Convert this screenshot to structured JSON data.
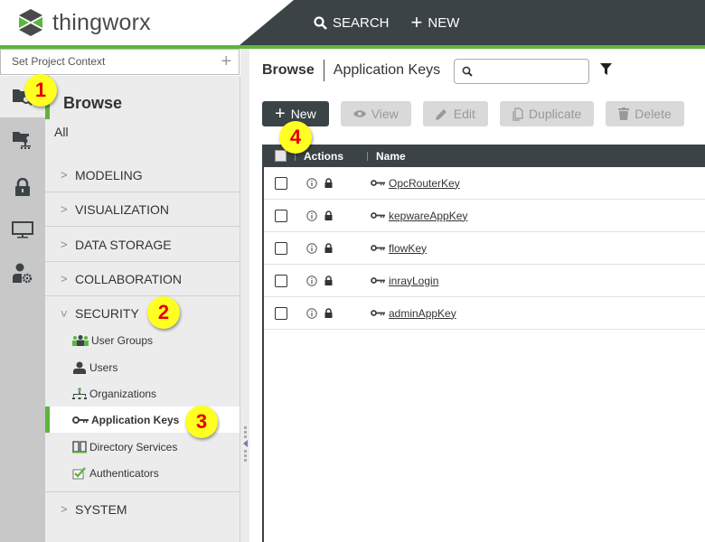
{
  "app": {
    "name": "thingworx"
  },
  "topnav": {
    "search_label": "SEARCH",
    "new_label": "NEW"
  },
  "sidebar": {
    "project_context_placeholder": "Set Project Context",
    "title": "Browse",
    "all_label": "All",
    "categories": [
      {
        "label": "MODELING",
        "expanded": false
      },
      {
        "label": "VISUALIZATION",
        "expanded": false
      },
      {
        "label": "DATA STORAGE",
        "expanded": false
      },
      {
        "label": "COLLABORATION",
        "expanded": false
      },
      {
        "label": "SECURITY",
        "expanded": true
      },
      {
        "label": "SYSTEM",
        "expanded": false
      }
    ],
    "security_items": [
      {
        "label": "User Groups",
        "icon": "user-groups-icon"
      },
      {
        "label": "Users",
        "icon": "user-icon"
      },
      {
        "label": "Organizations",
        "icon": "organization-icon"
      },
      {
        "label": "Application Keys",
        "icon": "key-icon",
        "active": true
      },
      {
        "label": "Directory Services",
        "icon": "book-icon"
      },
      {
        "label": "Authenticators",
        "icon": "checkbox-check-icon"
      }
    ]
  },
  "rail": {
    "items": [
      "browse-icon",
      "project-folder-icon",
      "lock-icon",
      "monitor-icon",
      "user-settings-icon"
    ]
  },
  "main": {
    "breadcrumb": {
      "root": "Browse",
      "page": "Application Keys"
    },
    "search_placeholder": "",
    "toolbar": {
      "new": "New",
      "view": "View",
      "edit": "Edit",
      "duplicate": "Duplicate",
      "delete": "Delete"
    },
    "grid": {
      "columns": [
        "Actions",
        "Name"
      ],
      "rows": [
        {
          "name": "OpcRouterKey"
        },
        {
          "name": "kepwareAppKey"
        },
        {
          "name": "flowKey"
        },
        {
          "name": "inrayLogin"
        },
        {
          "name": "adminAppKey"
        }
      ]
    }
  },
  "markers": [
    "1",
    "2",
    "3",
    "4"
  ],
  "colors": {
    "accent_green": "#5bb63e",
    "dark": "#3b4346",
    "marker_yellow": "#ffff22",
    "marker_red": "#e30000"
  }
}
